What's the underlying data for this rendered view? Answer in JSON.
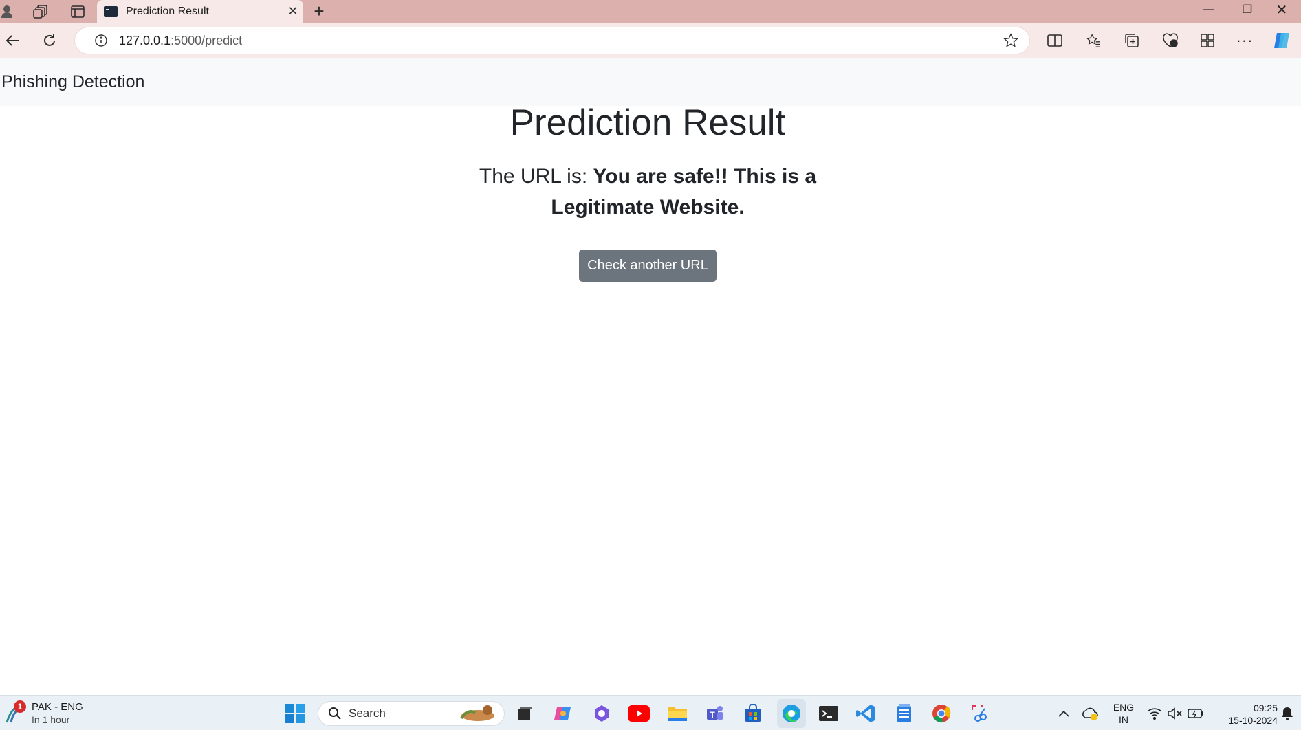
{
  "browser": {
    "tab_title": "Prediction Result",
    "tab_close": "✕",
    "new_tab": "+",
    "url_host": "127.0.0.1",
    "url_path": ":5000/predict",
    "window_controls": {
      "minimize": "—",
      "restore": "❐",
      "close": "✕"
    }
  },
  "app": {
    "brand": "Phishing Detection",
    "title": "Prediction Result",
    "result_prefix": "The URL is: ",
    "result_value": "You are safe!! This is a Legitimate Website.",
    "button_label": "Check another URL"
  },
  "taskbar": {
    "weather_line1": "PAK - ENG",
    "weather_line2": "In 1 hour",
    "weather_badge": "1",
    "search_label": "Search",
    "lang_line1": "ENG",
    "lang_line2": "IN",
    "time": "09:25",
    "date": "15-10-2024"
  },
  "colors": {
    "titlebar": "#dcb1ad",
    "addressbar": "#f7e9e8",
    "button": "#6c757d",
    "navbar": "#f8f9fa",
    "taskbar": "#e9f0f6"
  }
}
